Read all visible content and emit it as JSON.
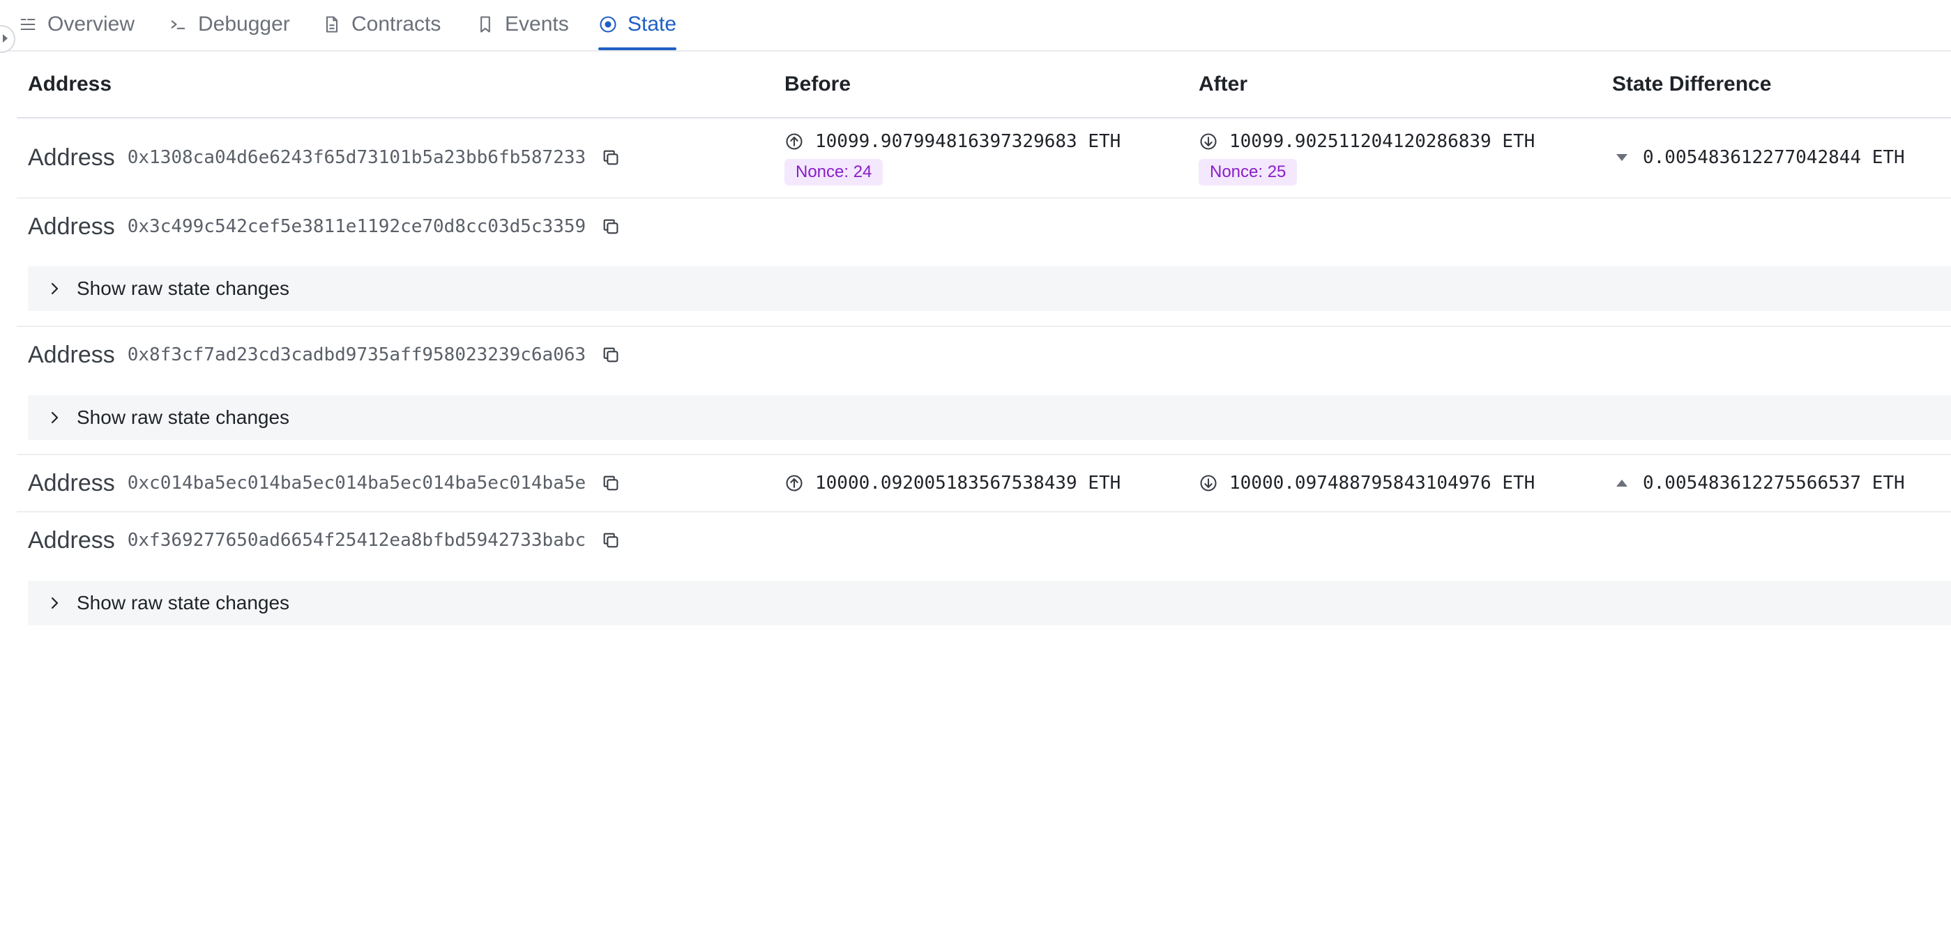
{
  "tabs": [
    {
      "label": "Overview",
      "icon": "list-icon",
      "active": false
    },
    {
      "label": "Debugger",
      "icon": "terminal-icon",
      "active": false
    },
    {
      "label": "Contracts",
      "icon": "document-icon",
      "active": false
    },
    {
      "label": "Events",
      "icon": "bookmark-icon",
      "active": false
    },
    {
      "label": "State",
      "icon": "target-icon",
      "active": true
    }
  ],
  "table": {
    "headers": {
      "address": "Address",
      "before": "Before",
      "after": "After",
      "diff": "State Difference"
    },
    "raw_label": "Show raw state changes",
    "rows": [
      {
        "label": "Address",
        "address": "0x1308ca04d6e6243f65d73101b5a23bb6fb587233",
        "before": "10099.907994816397329683 ETH",
        "before_nonce": "Nonce: 24",
        "after": "10099.902511204120286839 ETH",
        "after_nonce": "Nonce: 25",
        "diff": "0.005483612277042844 ETH",
        "diff_direction": "down"
      },
      {
        "label": "Address",
        "address": "0x3c499c542cef5e3811e1192ce70d8cc03d5c3359"
      },
      {
        "label": "Address",
        "address": "0x8f3cf7ad23cd3cadbd9735aff958023239c6a063"
      },
      {
        "label": "Address",
        "address": "0xc014ba5ec014ba5ec014ba5ec014ba5ec014ba5e",
        "before": "10000.092005183567538439 ETH",
        "after": "10000.097488795843104976 ETH",
        "diff": "0.005483612275566537 ETH",
        "diff_direction": "up"
      },
      {
        "label": "Address",
        "address": "0xf369277650ad6654f25412ea8bfbd5942733babc"
      }
    ]
  },
  "colors": {
    "accent": "#1f5fc4",
    "nonce_bg": "#f3e8fd",
    "nonce_text": "#8a1ec7",
    "raw_bg": "#f5f6f8"
  }
}
